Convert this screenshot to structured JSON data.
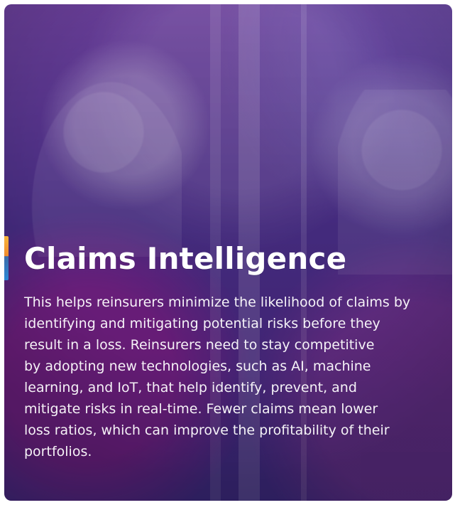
{
  "card": {
    "title": "Claims Intelligence",
    "description": "This helps reinsurers minimize the likelihood of claims by\nidentifying and mitigating  potential risks before they\nresult in a loss. Reinsurers need to stay competitive\nby adopting new  technologies, such as AI, machine\nlearning, and IoT, that help identify, prevent, and\nmitigate risks in real-time. Fewer claims mean lower\nloss ratios, which can improve the profitability of their\nportfolios."
  },
  "colors": {
    "accent_orange": "#F08A2D",
    "accent_blue": "#2A88D6",
    "overlay_purple": "#4A2E89",
    "overlay_magenta": "#D02A86"
  }
}
